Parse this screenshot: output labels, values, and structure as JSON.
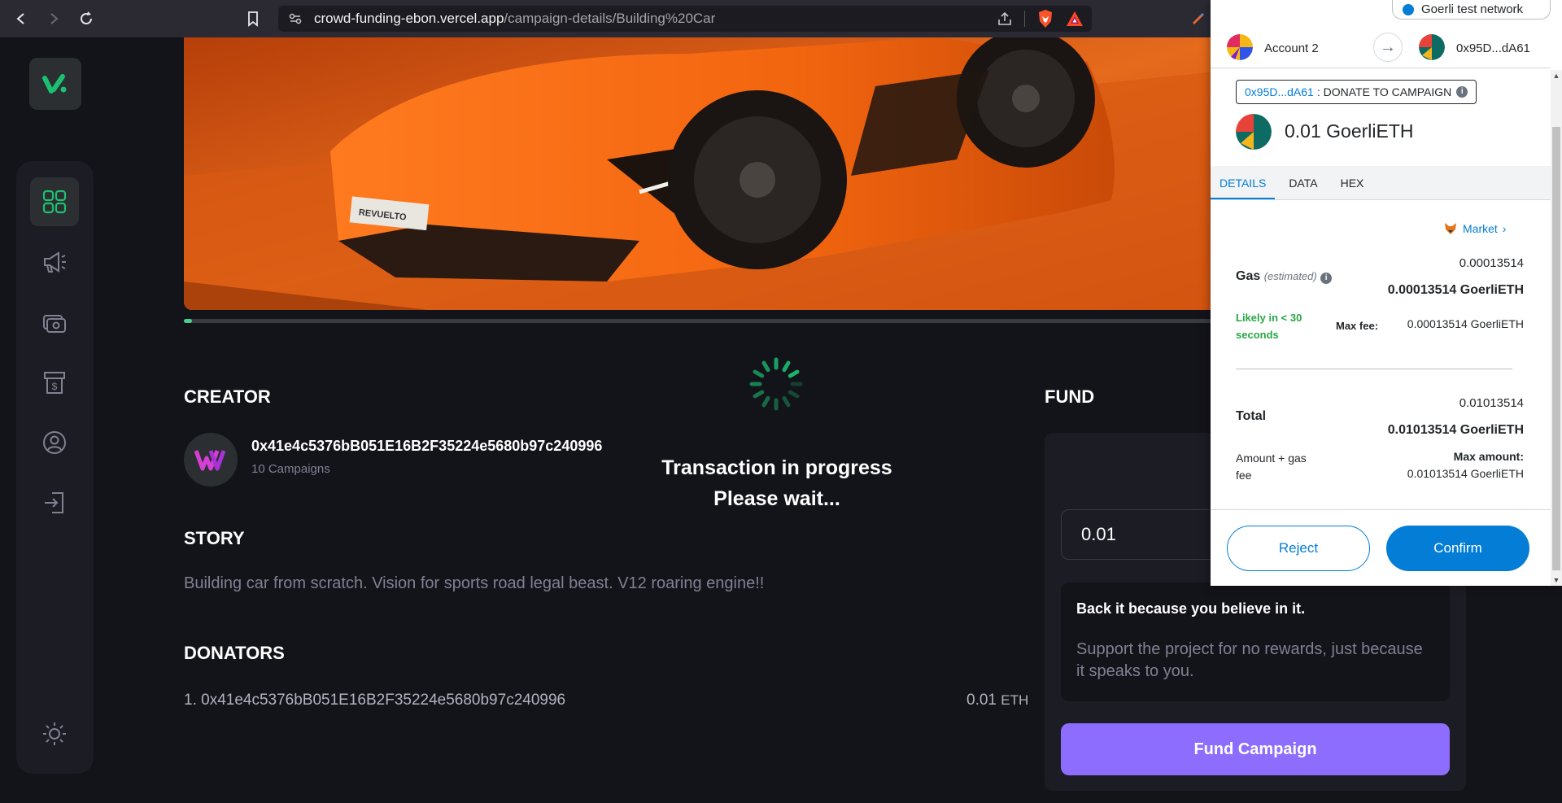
{
  "browser": {
    "url_domain": "crowd-funding-ebon.vercel.app",
    "url_path": "/campaign-details/Building%20Car"
  },
  "sidebar": {
    "items": [
      {
        "icon": "dashboard-icon",
        "active": true
      },
      {
        "icon": "megaphone-icon",
        "active": false
      },
      {
        "icon": "payment-icon",
        "active": false
      },
      {
        "icon": "withdraw-icon",
        "active": false
      },
      {
        "icon": "profile-icon",
        "active": false
      },
      {
        "icon": "logout-icon",
        "active": false
      },
      {
        "icon": "sun-icon",
        "active": false
      }
    ]
  },
  "campaign": {
    "progress_fraction": 0.008,
    "creator_title": "CREATOR",
    "creator_address": "0x41e4c5376bB051E16B2F35224e5680b97c240996",
    "creator_campaigns": "10 Campaigns",
    "story_title": "STORY",
    "story_text": "Building car from scratch. Vision for sports road legal beast. V12 roaring engine!!",
    "donators_title": "DONATORS",
    "donators": [
      {
        "label": "1. 0x41e4c5376bB051E16B2F35224e5680b97c240996",
        "amount": "0.01",
        "unit": "ETH"
      }
    ]
  },
  "loader": {
    "line1": "Transaction in progress",
    "line2": "Please wait..."
  },
  "fund": {
    "title": "FUND",
    "heading": "Fund",
    "amount_value": "0.01",
    "note_title": "Back it because you believe in it.",
    "note_desc": "Support the project for no rewards, just because it speaks to you.",
    "button_label": "Fund Campaign"
  },
  "metamask": {
    "network": "Goerli test network",
    "account_from": "Account 2",
    "account_to": "0x95D...dA61",
    "origin_address": "0x95D...dA61",
    "origin_action": ": DONATE TO CAMPAIGN",
    "amount": "0.01 GoerliETH",
    "tabs": [
      "DETAILS",
      "DATA",
      "HEX"
    ],
    "active_tab": "DETAILS",
    "market_label": "Market",
    "gas_label": "Gas",
    "gas_estimated": "(estimated)",
    "gas_value": "0.00013514",
    "gas_value_bold": "0.00013514 GoerliETH",
    "likely_text": "Likely in < 30 seconds",
    "max_fee_label": "Max fee:",
    "max_fee_value": "0.00013514 GoerliETH",
    "total_label": "Total",
    "total_value": "0.01013514",
    "total_value_bold": "0.01013514 GoerliETH",
    "amount_gas_label": "Amount + gas fee",
    "max_amount_label": "Max amount:",
    "max_amount_value": "0.01013514 GoerliETH",
    "reject_label": "Reject",
    "confirm_label": "Confirm"
  },
  "colors": {
    "accent_green": "#4acd8d",
    "accent_purple": "#8c6dfd",
    "metamask_blue": "#037dd6"
  }
}
